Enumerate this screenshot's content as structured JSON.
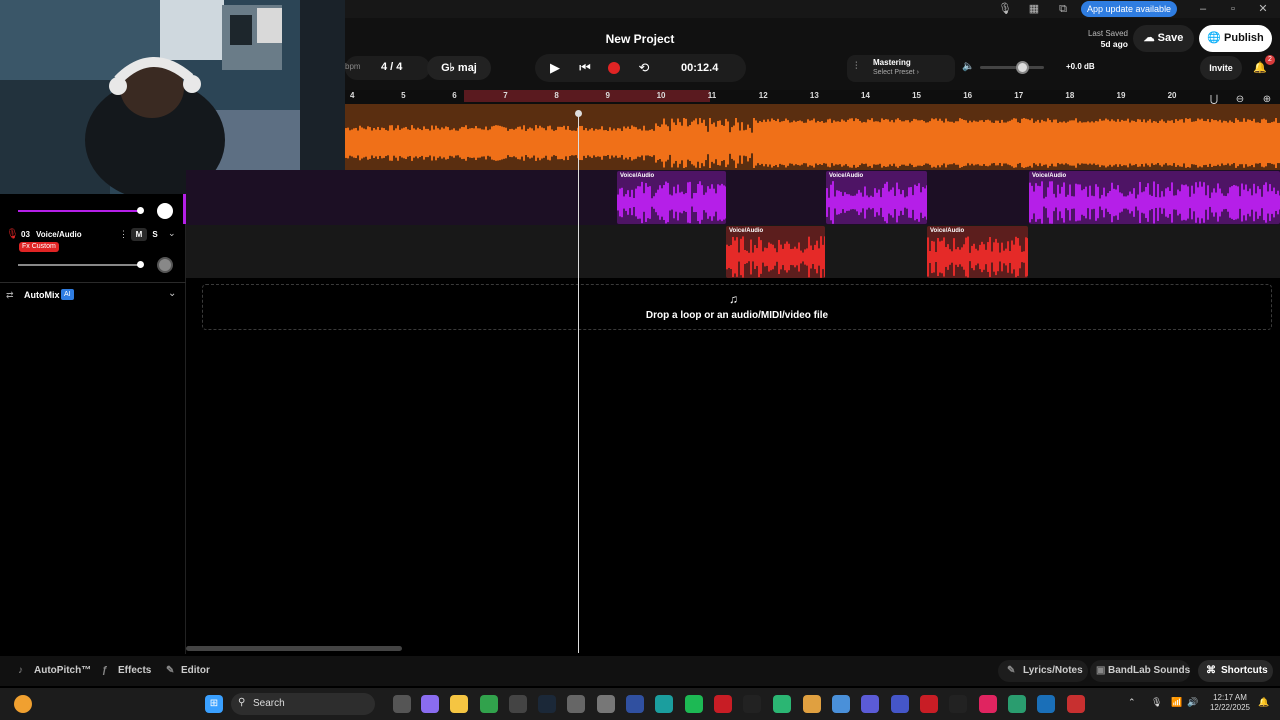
{
  "window": {
    "title": "New Project",
    "update_label": "App update available",
    "update_menu_icon": "⋮"
  },
  "header": {
    "last_saved_label": "Last Saved",
    "last_saved_value": "5d ago",
    "save_label": "Save",
    "publish_label": "Publish",
    "invite_label": "Invite",
    "notification_count": "2"
  },
  "transport": {
    "bpm_suffix": "bpm",
    "time_signature": "4 / 4",
    "key": "G♭ maj",
    "time": "00:12.4",
    "mastering_label": "Mastering",
    "mastering_preset": "Select Preset",
    "mastering_chevron": "›",
    "volume_db": "+0.0 dB",
    "volume_level": 0.65
  },
  "ruler": {
    "bars": [
      "4",
      "5",
      "6",
      "7",
      "8",
      "9",
      "10",
      "11",
      "12",
      "13",
      "14",
      "15",
      "16",
      "17",
      "18",
      "19",
      "20"
    ]
  },
  "tracks": {
    "track2_name": "Voice/Audio",
    "track3": {
      "number": "03",
      "name": "Voice/Audio",
      "fx_label": "Fx Custom",
      "mute": "M",
      "solo": "S"
    },
    "clip_label": "Voice/Audio",
    "automix_label": "AutoMix",
    "automix_badge": "AI"
  },
  "drop_zone": {
    "text": "Drop a loop or an audio/MIDI/video file"
  },
  "bottom_bar": {
    "autopitch": "AutoPitch™",
    "effects": "Effects",
    "editor": "Editor",
    "lyrics": "Lyrics/Notes",
    "sounds": "BandLab Sounds",
    "shortcuts": "Shortcuts"
  },
  "taskbar": {
    "search_placeholder": "Search",
    "time": "12:17 AM",
    "date": "12/22/2025"
  },
  "colors": {
    "orange": "#f07018",
    "purple": "#b51fe8",
    "red": "#e52a28",
    "accent": "#2f7de1"
  }
}
